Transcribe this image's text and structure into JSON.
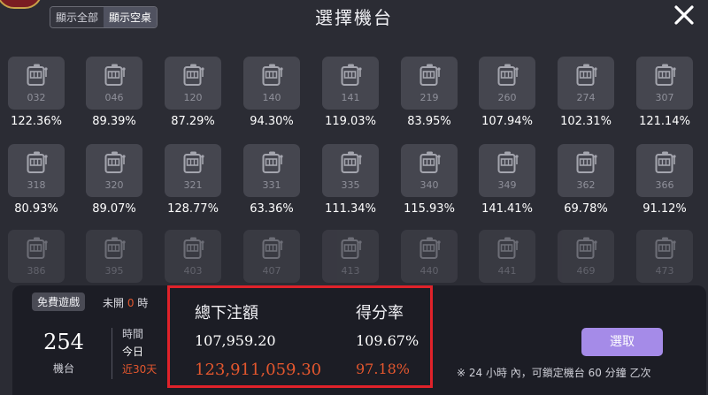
{
  "header": {
    "title": "選擇機台",
    "filters": [
      {
        "label": "顯示全部",
        "active": false
      },
      {
        "label": "顯示空桌",
        "active": true
      }
    ]
  },
  "machines": [
    {
      "id": "032",
      "rate": "122.36%"
    },
    {
      "id": "046",
      "rate": "89.39%"
    },
    {
      "id": "120",
      "rate": "87.29%"
    },
    {
      "id": "140",
      "rate": "94.30%"
    },
    {
      "id": "141",
      "rate": "119.03%"
    },
    {
      "id": "219",
      "rate": "83.95%"
    },
    {
      "id": "260",
      "rate": "107.94%"
    },
    {
      "id": "274",
      "rate": "102.31%"
    },
    {
      "id": "307",
      "rate": "121.14%"
    },
    {
      "id": "318",
      "rate": "80.93%"
    },
    {
      "id": "320",
      "rate": "89.07%"
    },
    {
      "id": "321",
      "rate": "128.77%"
    },
    {
      "id": "331",
      "rate": "63.36%"
    },
    {
      "id": "335",
      "rate": "111.34%"
    },
    {
      "id": "340",
      "rate": "115.93%"
    },
    {
      "id": "349",
      "rate": "141.41%"
    },
    {
      "id": "362",
      "rate": "69.78%"
    },
    {
      "id": "366",
      "rate": "91.12%"
    },
    {
      "id": "386",
      "rate": ""
    },
    {
      "id": "395",
      "rate": ""
    },
    {
      "id": "403",
      "rate": ""
    },
    {
      "id": "407",
      "rate": ""
    },
    {
      "id": "413",
      "rate": ""
    },
    {
      "id": "440",
      "rate": ""
    },
    {
      "id": "441",
      "rate": ""
    },
    {
      "id": "469",
      "rate": ""
    },
    {
      "id": "473",
      "rate": ""
    }
  ],
  "panel": {
    "free_game_label": "免費遊戲",
    "free_status_prefix": "未開",
    "free_status_count": "0",
    "free_status_suffix": "時",
    "machine_count": "254",
    "machine_count_label": "機台",
    "period_title": "時間",
    "period_today": "今日",
    "period_30": "近30天",
    "stats": {
      "bet_header": "總下注額",
      "rate_header": "得分率",
      "bet_today": "107,959.20",
      "rate_today": "109.67%",
      "bet_30": "123,911,059.30",
      "rate_30": "97.18%"
    },
    "select_label": "選取",
    "note": "※ 24 小時 內，可鎖定機台 60 分鐘 乙次"
  }
}
